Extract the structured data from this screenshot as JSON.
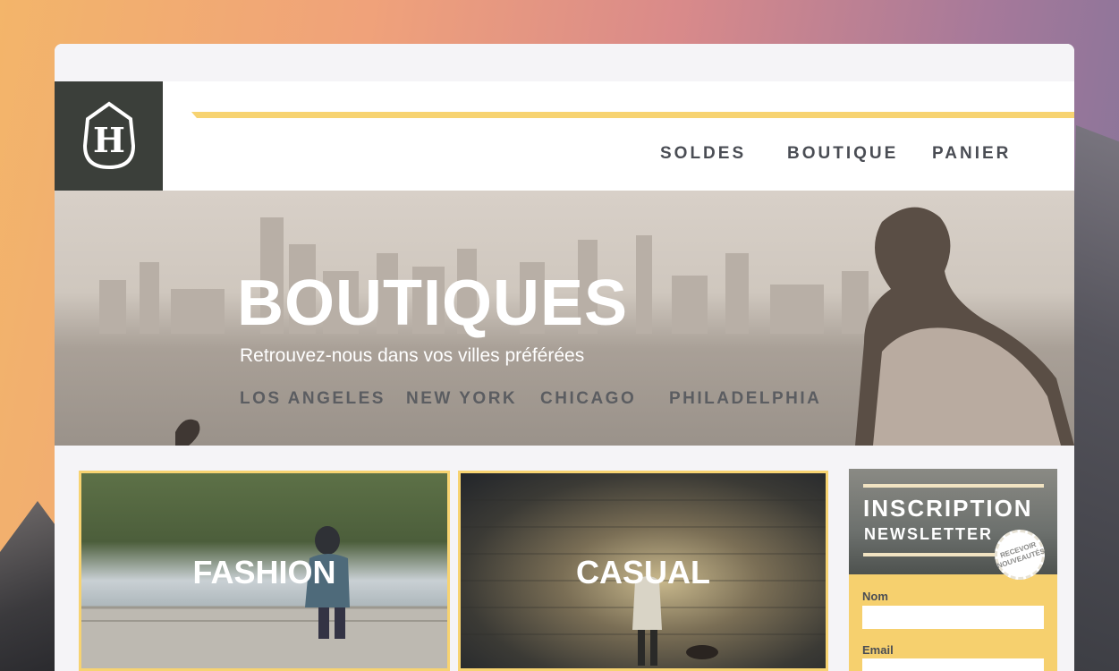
{
  "nav": {
    "items": [
      {
        "label": "SOLDES"
      },
      {
        "label": "BOUTIQUE"
      },
      {
        "label": "PANIER"
      }
    ]
  },
  "logo": {
    "icon": "shield-h-logo",
    "letter": "H"
  },
  "hero": {
    "title": "BOUTIQUES",
    "subtitle": "Retrouvez-nous dans vos villes préférées",
    "cities": [
      "LOS ANGELES",
      "NEW YORK",
      "CHICAGO",
      "PHILADELPHIA"
    ]
  },
  "categories": [
    {
      "label": "FASHION"
    },
    {
      "label": "CASUAL"
    }
  ],
  "newsletter": {
    "title": "INSCRIPTION",
    "subtitle": "NEWSLETTER",
    "badge_line1": "RECEVOIR",
    "badge_line2": "NOUVEAUTÉS",
    "fields": [
      {
        "label": "Nom",
        "value": ""
      },
      {
        "label": "Email",
        "value": ""
      }
    ]
  },
  "colors": {
    "accent": "#f7d371",
    "logo_bg": "#3b3f3a",
    "nav_text": "#4a4d54"
  }
}
